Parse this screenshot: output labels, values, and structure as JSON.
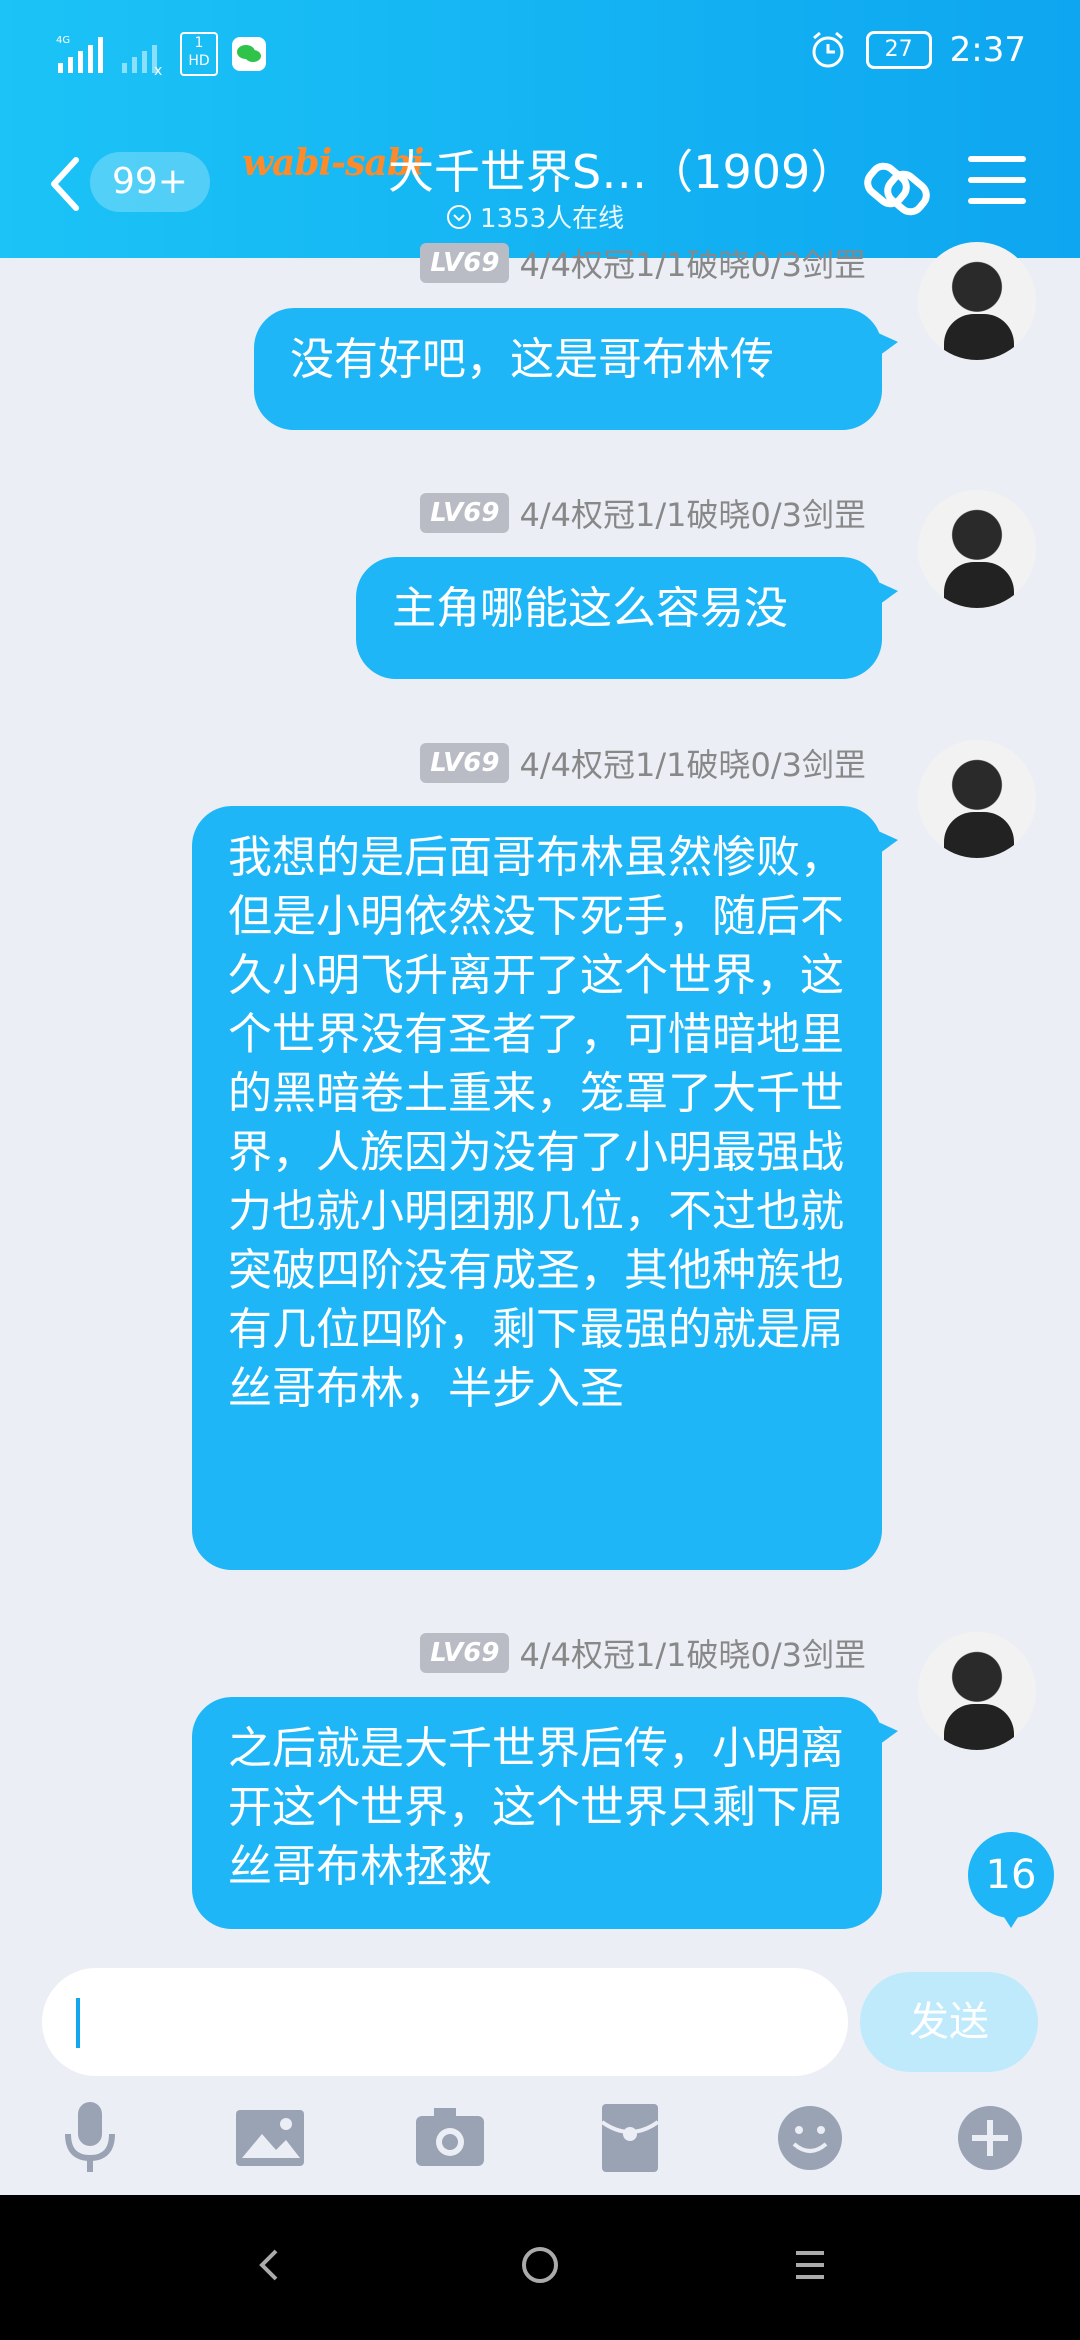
{
  "status_bar": {
    "network": "4G",
    "sim2": "HD",
    "battery": "27",
    "time": "2:37"
  },
  "header": {
    "unread_count": "99+",
    "group_logo_text": "wabi-sabi",
    "group_title": "大千世界S…（1909）",
    "online": "1353人在线"
  },
  "messages": [
    {
      "level": "LV69",
      "title": "4/4权冠1/1破晓0/3剑罡",
      "text": "没有好吧，这是哥布林传"
    },
    {
      "level": "LV69",
      "title": "4/4权冠1/1破晓0/3剑罡",
      "text": "主角哪能这么容易没"
    },
    {
      "level": "LV69",
      "title": "4/4权冠1/1破晓0/3剑罡",
      "text": "我想的是后面哥布林虽然惨败，但是小明依然没下死手，随后不久小明飞升离开了这个世界，这个世界没有圣者了，可惜暗地里的黑暗卷土重来，笼罩了大千世界，人族因为没有了小明最强战力也就小明团那几位，不过也就突破四阶没有成圣，其他种族也有几位四阶，剩下最强的就是屌丝哥布林，半步入圣"
    },
    {
      "level": "LV69",
      "title": "4/4权冠1/1破晓0/3剑罡",
      "text": "之后就是大千世界后传，小明离开这个世界，这个世界只剩下屌丝哥布林拯救"
    }
  ],
  "new_message_count": "16",
  "input": {
    "value": "",
    "send_label": "发送"
  },
  "toolbar": [
    "mic-icon",
    "image-icon",
    "camera-icon",
    "red-packet-icon",
    "emoji-icon",
    "plus-icon"
  ]
}
